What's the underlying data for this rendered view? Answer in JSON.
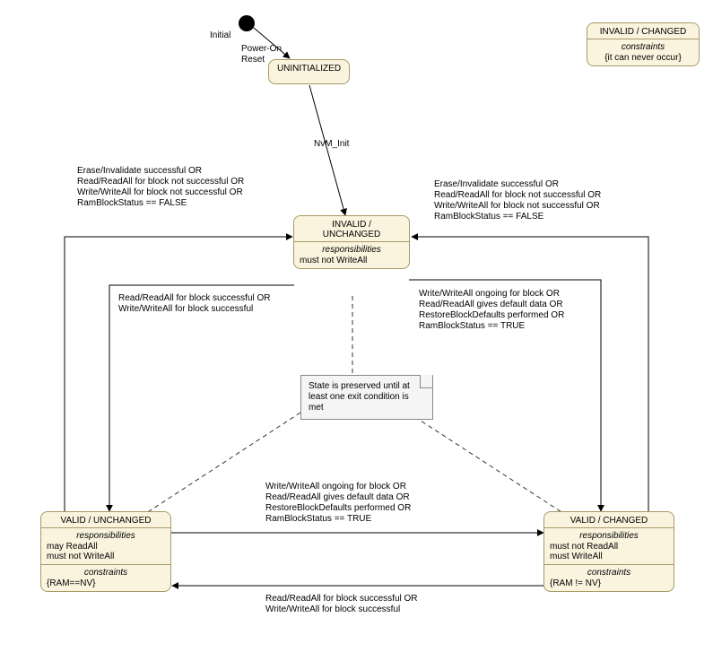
{
  "initial_label": "Initial",
  "power_on": "Power-On\nReset",
  "nvm_init": "NvM_Init",
  "node_uninit": {
    "title": "UNINITIALIZED"
  },
  "node_invalid_unchanged": {
    "title": "INVALID /\nUNCHANGED",
    "resp_hdr": "responsibilities",
    "resp_body": "must not WriteAll"
  },
  "node_valid_unchanged": {
    "title": "VALID / UNCHANGED",
    "resp_hdr": "responsibilities",
    "resp_body": "may ReadAll\nmust not WriteAll",
    "con_hdr": "constraints",
    "con_body": "{RAM==NV}"
  },
  "node_valid_changed": {
    "title": "VALID / CHANGED",
    "resp_hdr": "responsibilities",
    "resp_body": "must not ReadAll\nmust WriteAll",
    "con_hdr": "constraints",
    "con_body": "{RAM != NV}"
  },
  "node_invalid_changed": {
    "title": "INVALID / CHANGED",
    "con_hdr": "constraints",
    "con_body": "{it can never occur}"
  },
  "note_text": "State is preserved until at\nleast one exit condition is\nmet",
  "trans_left_up": "Erase/Invalidate successful OR\nRead/ReadAll for block not successful OR\nWrite/WriteAll for block not successful OR\nRamBlockStatus == FALSE",
  "trans_right_up": "Erase/Invalidate successful OR\nRead/ReadAll for block not successful OR\nWrite/WriteAll for block not successful OR\nRamBlockStatus == FALSE",
  "trans_left_down": "Read/ReadAll for block successful OR\nWrite/WriteAll for block successful",
  "trans_right_down": "Write/WriteAll ongoing for block OR\nRead/ReadAll gives default data OR\nRestoreBlockDefaults performed OR\nRamBlockStatus == TRUE",
  "trans_vu_to_vc": "Write/WriteAll ongoing for block OR\nRead/ReadAll gives default data OR\nRestoreBlockDefaults performed OR\nRamBlockStatus == TRUE",
  "trans_vc_to_vu": "Read/ReadAll for block successful OR\nWrite/WriteAll for block successful"
}
